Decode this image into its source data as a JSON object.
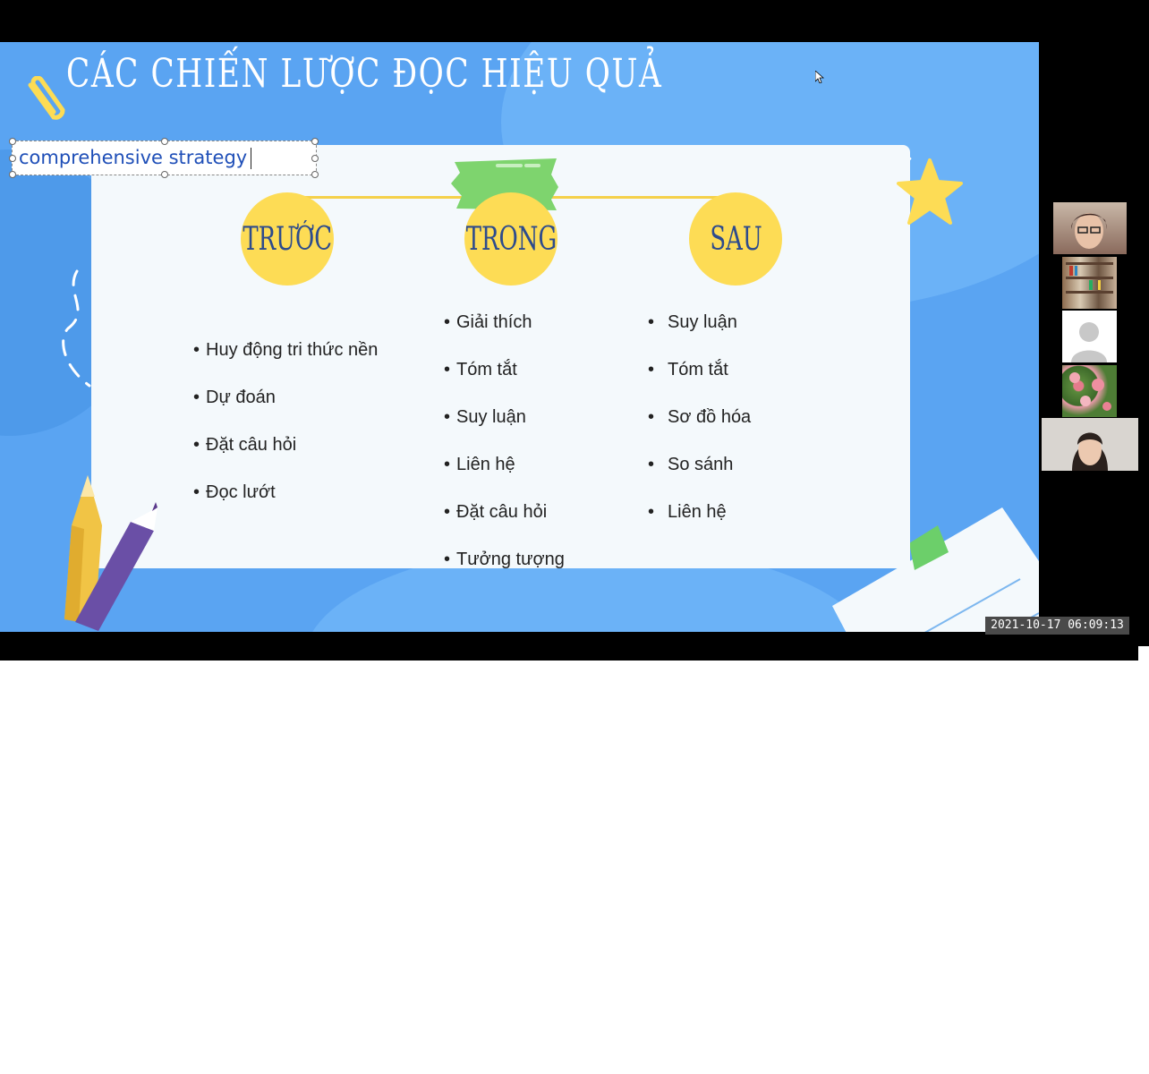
{
  "slide": {
    "title": "CÁC CHIẾN LƯỢC ĐỌC HIỆU QUẢ",
    "annotation_text": "comprehensive strategy",
    "columns": [
      {
        "heading": "TRƯỚC",
        "items": [
          "Huy động tri thức nền",
          "Dự đoán",
          "Đặt câu hỏi",
          "Đọc lướt"
        ]
      },
      {
        "heading": "TRONG",
        "items": [
          "Giải thích",
          "Tóm tắt",
          "Suy luận",
          "Liên hệ",
          "Đặt câu hỏi",
          "Tưởng tượng"
        ]
      },
      {
        "heading": "SAU",
        "items": [
          "Suy luận",
          "Tóm tắt",
          "Sơ đồ hóa",
          "So sánh",
          "Liên hệ"
        ]
      }
    ]
  },
  "recording": {
    "timestamp": "2021-10-17 06:09:13"
  },
  "colors": {
    "slide_bg": "#5aa4f2",
    "circle": "#fddc55",
    "heading_text": "#2d4b8d",
    "annotation_text": "#1f4fb8"
  },
  "participants": [
    {
      "icon": "participant-video-icon"
    },
    {
      "icon": "participant-video-icon"
    },
    {
      "icon": "avatar-placeholder-icon"
    },
    {
      "icon": "participant-video-icon"
    },
    {
      "icon": "participant-video-icon"
    }
  ]
}
